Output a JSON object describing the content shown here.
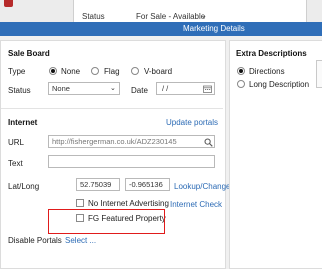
{
  "background": {
    "status_label": "Status",
    "status_value": "For Sale - Available",
    "status_chevron": "chevron-down-icon"
  },
  "window": {
    "title": "Marketing Details"
  },
  "sale_board": {
    "title": "Sale Board",
    "type_label": "Type",
    "type_options": [
      "None",
      "Flag",
      "V-board"
    ],
    "type_selected": "None",
    "status_label": "Status",
    "status_value": "None",
    "date_label": "Date",
    "date_value": "/ /"
  },
  "internet": {
    "title": "Internet",
    "update_portals_link": "Update portals",
    "url_label": "URL",
    "url_value": "http://fishergerman.co.uk/ADZ230145",
    "text_label": "Text",
    "text_value": "",
    "latlong_label": "Lat/Long",
    "lat_value": "52.75039",
    "long_value": "-0.965136",
    "lookup_change_link": "Lookup/Change",
    "no_internet_advertising_label": "No Internet Advertising",
    "internet_check_link": "Internet Check",
    "fg_featured_property_label": "FG Featured Property",
    "disable_portals_label": "Disable Portals",
    "select_link": "Select ..."
  },
  "extra_descriptions": {
    "title": "Extra Descriptions",
    "options": [
      "Directions",
      "Long Description"
    ],
    "selected": "Directions"
  },
  "colors": {
    "titlebar": "#2f6eb8",
    "link": "#2c6bb5",
    "highlight": "#e01b1b",
    "background_icon": "#b62a2a"
  },
  "icons": {
    "search": "search-icon",
    "calendar": "calendar-icon",
    "dropdown": "chevron-down-icon"
  }
}
